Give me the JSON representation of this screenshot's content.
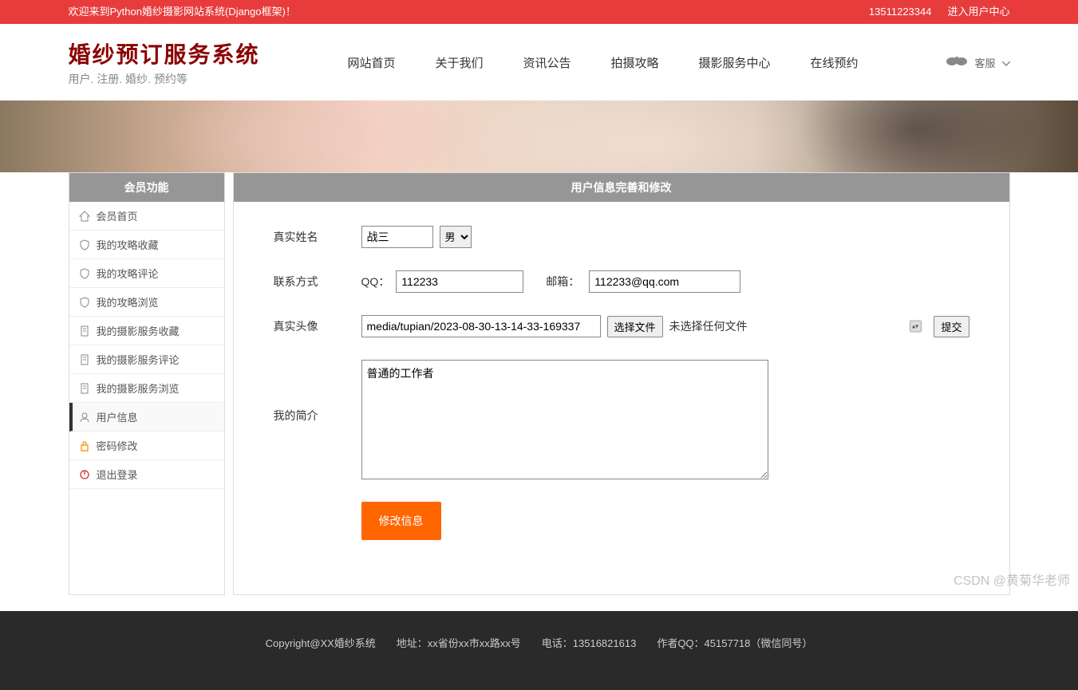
{
  "topbar": {
    "welcome": "欢迎来到Python婚纱摄影网站系统(Django框架)！",
    "phone": "13511223344",
    "user_center": "进入用户中心"
  },
  "header": {
    "logo_title": "婚纱预订服务系统",
    "logo_sub": "用户. 注册. 婚纱. 预约等",
    "nav": [
      "网站首页",
      "关于我们",
      "资讯公告",
      "拍摄攻略",
      "摄影服务中心",
      "在线预约"
    ],
    "service": "客服"
  },
  "sidebar": {
    "title": "会员功能",
    "items": [
      {
        "label": "会员首页",
        "icon": "home"
      },
      {
        "label": "我的攻略收藏",
        "icon": "shield"
      },
      {
        "label": "我的攻略评论",
        "icon": "shield"
      },
      {
        "label": "我的攻略浏览",
        "icon": "shield"
      },
      {
        "label": "我的摄影服务收藏",
        "icon": "doc"
      },
      {
        "label": "我的摄影服务评论",
        "icon": "doc"
      },
      {
        "label": "我的摄影服务浏览",
        "icon": "doc"
      },
      {
        "label": "用户信息",
        "icon": "user",
        "active": true
      },
      {
        "label": "密码修改",
        "icon": "lock"
      },
      {
        "label": "退出登录",
        "icon": "power"
      }
    ]
  },
  "panel": {
    "title": "用户信息完善和修改",
    "labels": {
      "realname": "真实姓名",
      "contact": "联系方式",
      "qq_label": "QQ：",
      "email_label": "邮箱：",
      "avatar": "真实头像",
      "bio": "我的简介"
    },
    "values": {
      "realname": "战三",
      "gender": "男",
      "qq": "112233",
      "email": "112233@qq.com",
      "avatar_path": "media/tupian/2023-08-30-13-14-33-169337",
      "bio": "普通的工作者"
    },
    "buttons": {
      "choose_file": "选择文件",
      "no_file": "未选择任何文件",
      "submit_small": "提交",
      "submit": "修改信息"
    }
  },
  "footer": {
    "text": "Copyright@XX婚纱系统　　地址：xx省份xx市xx路xx号　　电话：13516821613　　作者QQ：45157718（微信同号）"
  },
  "watermark": "CSDN @黄菊华老师"
}
